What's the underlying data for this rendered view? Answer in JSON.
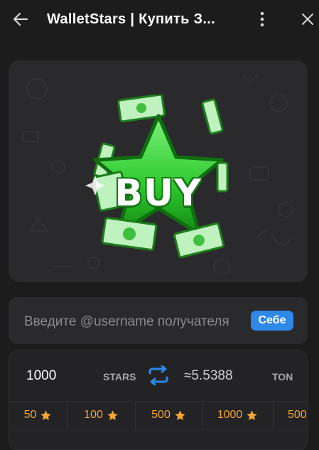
{
  "header": {
    "title": "WalletStars | Купить З...",
    "back_icon": "arrow-left-icon",
    "menu_icon": "more-vertical-icon",
    "close_icon": "close-icon"
  },
  "hero": {
    "image_text": "BUY",
    "colors": {
      "star": "#2fd22f",
      "money": "#6fe06f",
      "background": "#2a2a2c"
    }
  },
  "recipient": {
    "placeholder": "Введите @username получателя",
    "value": "",
    "self_button_label": "Себе",
    "accent": "#2d88e8"
  },
  "exchange": {
    "amount": "1000",
    "from_currency": "STARS",
    "to_amount": "≈5.5388",
    "to_currency": "TON",
    "swap_icon": "swap-icon"
  },
  "presets": [
    {
      "label": "50"
    },
    {
      "label": "100"
    },
    {
      "label": "500"
    },
    {
      "label": "1000"
    },
    {
      "label": "500"
    }
  ],
  "colors": {
    "star_accent": "#f4a630",
    "background": "#1c1c1d"
  }
}
